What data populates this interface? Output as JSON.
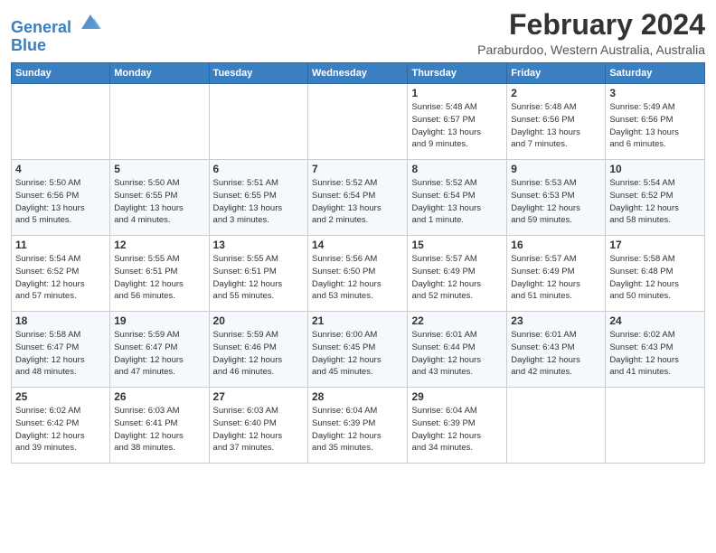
{
  "logo": {
    "line1": "General",
    "line2": "Blue"
  },
  "title": "February 2024",
  "location": "Paraburdoo, Western Australia, Australia",
  "weekdays": [
    "Sunday",
    "Monday",
    "Tuesday",
    "Wednesday",
    "Thursday",
    "Friday",
    "Saturday"
  ],
  "weeks": [
    [
      {
        "day": "",
        "info": ""
      },
      {
        "day": "",
        "info": ""
      },
      {
        "day": "",
        "info": ""
      },
      {
        "day": "",
        "info": ""
      },
      {
        "day": "1",
        "info": "Sunrise: 5:48 AM\nSunset: 6:57 PM\nDaylight: 13 hours\nand 9 minutes."
      },
      {
        "day": "2",
        "info": "Sunrise: 5:48 AM\nSunset: 6:56 PM\nDaylight: 13 hours\nand 7 minutes."
      },
      {
        "day": "3",
        "info": "Sunrise: 5:49 AM\nSunset: 6:56 PM\nDaylight: 13 hours\nand 6 minutes."
      }
    ],
    [
      {
        "day": "4",
        "info": "Sunrise: 5:50 AM\nSunset: 6:56 PM\nDaylight: 13 hours\nand 5 minutes."
      },
      {
        "day": "5",
        "info": "Sunrise: 5:50 AM\nSunset: 6:55 PM\nDaylight: 13 hours\nand 4 minutes."
      },
      {
        "day": "6",
        "info": "Sunrise: 5:51 AM\nSunset: 6:55 PM\nDaylight: 13 hours\nand 3 minutes."
      },
      {
        "day": "7",
        "info": "Sunrise: 5:52 AM\nSunset: 6:54 PM\nDaylight: 13 hours\nand 2 minutes."
      },
      {
        "day": "8",
        "info": "Sunrise: 5:52 AM\nSunset: 6:54 PM\nDaylight: 13 hours\nand 1 minute."
      },
      {
        "day": "9",
        "info": "Sunrise: 5:53 AM\nSunset: 6:53 PM\nDaylight: 12 hours\nand 59 minutes."
      },
      {
        "day": "10",
        "info": "Sunrise: 5:54 AM\nSunset: 6:52 PM\nDaylight: 12 hours\nand 58 minutes."
      }
    ],
    [
      {
        "day": "11",
        "info": "Sunrise: 5:54 AM\nSunset: 6:52 PM\nDaylight: 12 hours\nand 57 minutes."
      },
      {
        "day": "12",
        "info": "Sunrise: 5:55 AM\nSunset: 6:51 PM\nDaylight: 12 hours\nand 56 minutes."
      },
      {
        "day": "13",
        "info": "Sunrise: 5:55 AM\nSunset: 6:51 PM\nDaylight: 12 hours\nand 55 minutes."
      },
      {
        "day": "14",
        "info": "Sunrise: 5:56 AM\nSunset: 6:50 PM\nDaylight: 12 hours\nand 53 minutes."
      },
      {
        "day": "15",
        "info": "Sunrise: 5:57 AM\nSunset: 6:49 PM\nDaylight: 12 hours\nand 52 minutes."
      },
      {
        "day": "16",
        "info": "Sunrise: 5:57 AM\nSunset: 6:49 PM\nDaylight: 12 hours\nand 51 minutes."
      },
      {
        "day": "17",
        "info": "Sunrise: 5:58 AM\nSunset: 6:48 PM\nDaylight: 12 hours\nand 50 minutes."
      }
    ],
    [
      {
        "day": "18",
        "info": "Sunrise: 5:58 AM\nSunset: 6:47 PM\nDaylight: 12 hours\nand 48 minutes."
      },
      {
        "day": "19",
        "info": "Sunrise: 5:59 AM\nSunset: 6:47 PM\nDaylight: 12 hours\nand 47 minutes."
      },
      {
        "day": "20",
        "info": "Sunrise: 5:59 AM\nSunset: 6:46 PM\nDaylight: 12 hours\nand 46 minutes."
      },
      {
        "day": "21",
        "info": "Sunrise: 6:00 AM\nSunset: 6:45 PM\nDaylight: 12 hours\nand 45 minutes."
      },
      {
        "day": "22",
        "info": "Sunrise: 6:01 AM\nSunset: 6:44 PM\nDaylight: 12 hours\nand 43 minutes."
      },
      {
        "day": "23",
        "info": "Sunrise: 6:01 AM\nSunset: 6:43 PM\nDaylight: 12 hours\nand 42 minutes."
      },
      {
        "day": "24",
        "info": "Sunrise: 6:02 AM\nSunset: 6:43 PM\nDaylight: 12 hours\nand 41 minutes."
      }
    ],
    [
      {
        "day": "25",
        "info": "Sunrise: 6:02 AM\nSunset: 6:42 PM\nDaylight: 12 hours\nand 39 minutes."
      },
      {
        "day": "26",
        "info": "Sunrise: 6:03 AM\nSunset: 6:41 PM\nDaylight: 12 hours\nand 38 minutes."
      },
      {
        "day": "27",
        "info": "Sunrise: 6:03 AM\nSunset: 6:40 PM\nDaylight: 12 hours\nand 37 minutes."
      },
      {
        "day": "28",
        "info": "Sunrise: 6:04 AM\nSunset: 6:39 PM\nDaylight: 12 hours\nand 35 minutes."
      },
      {
        "day": "29",
        "info": "Sunrise: 6:04 AM\nSunset: 6:39 PM\nDaylight: 12 hours\nand 34 minutes."
      },
      {
        "day": "",
        "info": ""
      },
      {
        "day": "",
        "info": ""
      }
    ]
  ]
}
